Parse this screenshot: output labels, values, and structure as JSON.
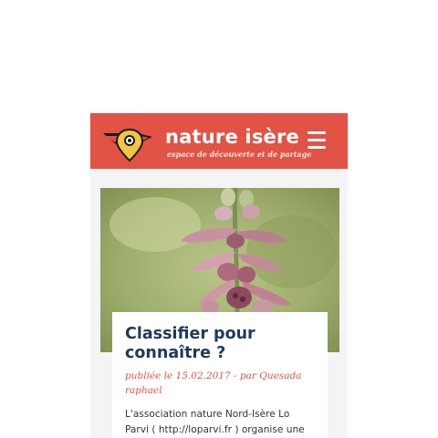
{
  "header": {
    "brand_name": "nature isère",
    "tagline": "espace de découverte et de partage",
    "menu_icon": "hamburger-menu-icon",
    "logo_icon": "bird-location-pin-logo",
    "background_color": "#e05345"
  },
  "article": {
    "image_subject": "orchid-flower-photo",
    "title": "Classifier pour connaître ?",
    "meta": "publiée le 15.02.2017 - par Quesada raphael",
    "excerpt": "L'association nature Nord-Isère Lo Parvi  ( http://loparvi.fr ) organise une journée d'étude sur le thème : le"
  },
  "colors": {
    "accent": "#e05345",
    "title": "#1e3a5c",
    "body_text": "#333333"
  }
}
